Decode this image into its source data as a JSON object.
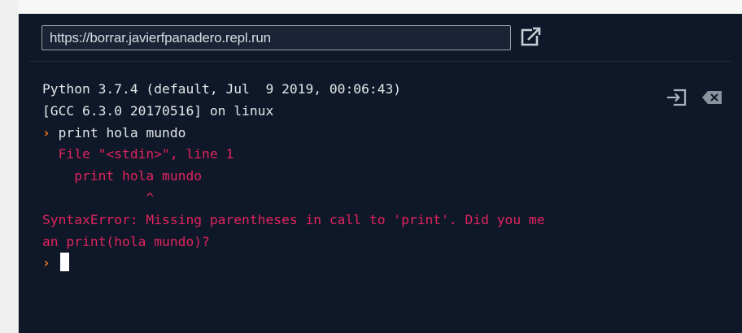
{
  "browser": {
    "url": "https://borrar.javierfpanadero.repl.run",
    "open_in_new_tab_icon": "external-link-icon"
  },
  "terminal": {
    "tool_icons": [
      "exit-icon",
      "clear-backspace-icon"
    ],
    "prompt_symbol": "›",
    "lines": [
      {
        "type": "output",
        "text": "Python 3.7.4 (default, Jul  9 2019, 00:06:43)"
      },
      {
        "type": "output",
        "text": "[GCC 6.3.0 20170516] on linux"
      },
      {
        "type": "input",
        "text": "print hola mundo"
      },
      {
        "type": "error",
        "text": "  File \"<stdin>\", line 1"
      },
      {
        "type": "error",
        "text": "    print hola mundo"
      },
      {
        "type": "error",
        "text": "             ^"
      },
      {
        "type": "error",
        "text": "SyntaxError: Missing parentheses in call to 'print'. Did you me"
      },
      {
        "type": "error",
        "text": "an print(hola mundo)?"
      }
    ],
    "current_input": ""
  },
  "colors": {
    "background": "#0f1828",
    "output_text": "#e4e6ea",
    "error_text": "#e0245e",
    "prompt": "#ff7a1a",
    "cursor": "#ffffff"
  }
}
